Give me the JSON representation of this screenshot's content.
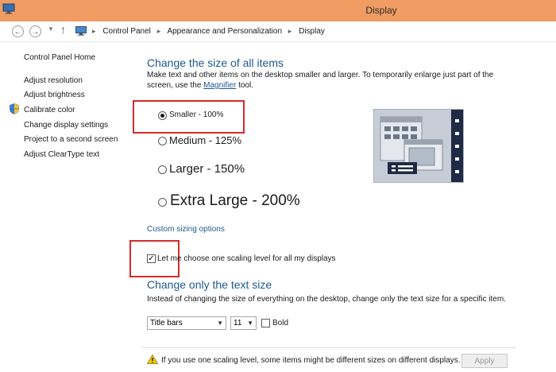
{
  "window": {
    "title": "Display"
  },
  "address": {
    "crumbs": [
      "Control Panel",
      "Appearance and Personalization",
      "Display"
    ]
  },
  "sidebar": {
    "home": "Control Panel Home",
    "items": [
      "Adjust resolution",
      "Adjust brightness",
      "Calibrate color",
      "Change display settings",
      "Project to a second screen",
      "Adjust ClearType text"
    ]
  },
  "main": {
    "heading": "Change the size of all items",
    "desc_before": "Make text and other items on the desktop smaller and larger. To temporarily enlarge just part of the screen, use the ",
    "desc_link": "Magnifier",
    "desc_after": " tool.",
    "options": [
      {
        "label": "Smaller - 100%",
        "checked": true
      },
      {
        "label": "Medium - 125%",
        "checked": false
      },
      {
        "label": "Larger - 150%",
        "checked": false
      },
      {
        "label": "Extra Large - 200%",
        "checked": false
      }
    ],
    "custom_link": "Custom sizing options",
    "scaling_checkbox": {
      "label": "Let me choose one scaling level for all my displays",
      "checked": true
    },
    "text_heading": "Change only the text size",
    "text_desc": "Instead of changing the size of everything on the desktop, change only the text size for a specific item.",
    "item_select": "Title bars",
    "size_select": "11",
    "bold_label": "Bold",
    "warning": "If you use one scaling level, some items might be different sizes on different displays.",
    "apply_label": "Apply"
  },
  "colors": {
    "titlebar": "#f09c63",
    "link": "#1e5a8f",
    "highlight": "#d62a2a"
  },
  "icons": [
    "app-icon",
    "back-arrow-icon",
    "forward-arrow-icon",
    "up-arrow-icon",
    "control-panel-icon",
    "shield-icon",
    "warning-icon"
  ]
}
